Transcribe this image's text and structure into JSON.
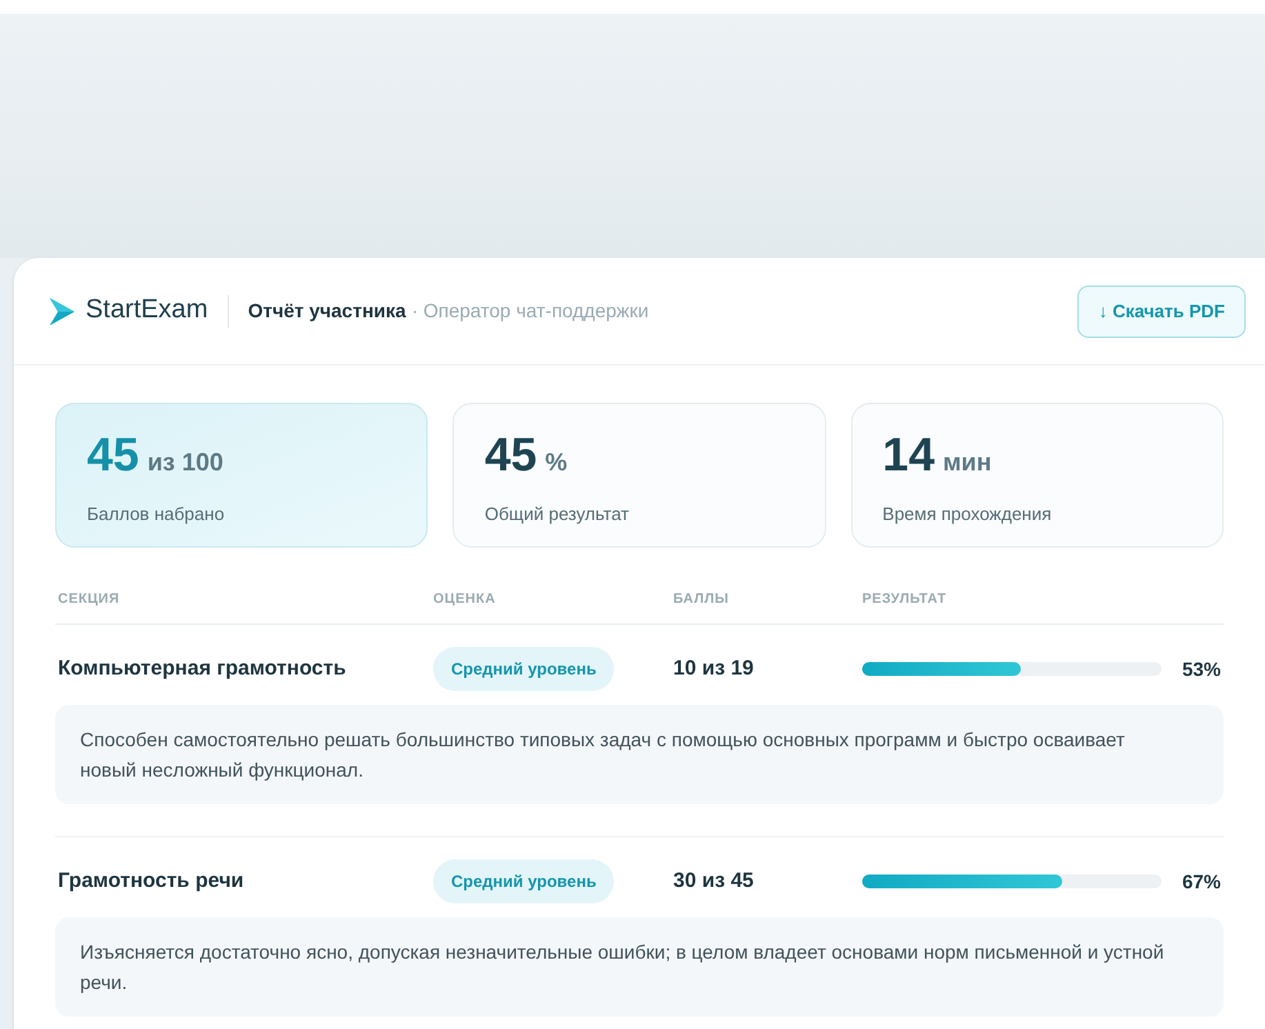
{
  "header": {
    "brand": "StartExam",
    "title": "Отчёт участника",
    "subtitle": "· Оператор чат-поддержки",
    "download_button": "↓ Скачать PDF"
  },
  "stats": [
    {
      "value": "45",
      "unit": "из 100",
      "label": "Баллов набрано",
      "highlighted": true
    },
    {
      "value": "45",
      "unit": "%",
      "label": "Общий результат",
      "highlighted": false
    },
    {
      "value": "14",
      "unit": "мин",
      "label": "Время прохождения",
      "highlighted": false
    }
  ],
  "table": {
    "columns": [
      "СЕКЦИЯ",
      "ОЦЕНКА",
      "БАЛЛЫ",
      "РЕЗУЛЬТАТ"
    ],
    "rows": [
      {
        "section": "Компьютерная грамотность",
        "grade": "Средний уровень",
        "points": "10 из 19",
        "level": 0.53,
        "result": "53%",
        "description": "Способен самостоятельно решать большинство типовых задач с помощью основных программ и быстро осваивает новый несложный функционал."
      },
      {
        "section": "Грамотность речи",
        "grade": "Средний уровень",
        "points": "30 из 45",
        "level": 0.67,
        "result": "67%",
        "description": "Изъясняется достаточно ясно, допуская незначительные ошибки; в целом владеет основами норм письменной и устной речи."
      }
    ]
  }
}
